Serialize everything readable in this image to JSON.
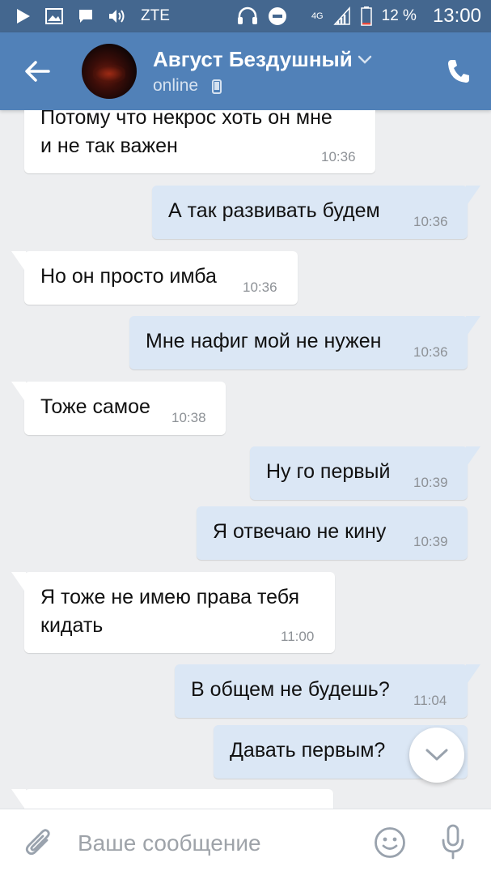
{
  "status_bar": {
    "carrier": "ZTE",
    "network": "4G",
    "battery": "12 %",
    "time": "13:00"
  },
  "header": {
    "contact_name": "Август Бездушный",
    "contact_status": "online"
  },
  "messages": [
    {
      "direction": "in",
      "text": "Потому что некрос хоть он мне\nи не так важен",
      "time": "10:36"
    },
    {
      "direction": "out",
      "text": "А так развивать будем",
      "time": "10:36"
    },
    {
      "direction": "in",
      "text": "Но он просто имба",
      "time": "10:36"
    },
    {
      "direction": "out",
      "text": "Мне нафиг мой не нужен",
      "time": "10:36"
    },
    {
      "direction": "in",
      "text": "Тоже самое",
      "time": "10:38"
    },
    {
      "direction": "out",
      "text": "Ну го первый",
      "time": "10:39"
    },
    {
      "direction": "out",
      "text": "Я отвечаю не кину",
      "time": "10:39"
    },
    {
      "direction": "in",
      "text": "Я тоже не имею права тебя\nкидать",
      "time": "11:00"
    },
    {
      "direction": "out",
      "text": "В общем не будешь?",
      "time": "11:04"
    },
    {
      "direction": "out",
      "text": "Давать первым?",
      "time": ""
    },
    {
      "direction": "in",
      "text": "",
      "time": ""
    }
  ],
  "input": {
    "placeholder": "Ваше сообщение",
    "value": ""
  },
  "colors": {
    "status_bar": "#44678f",
    "header": "#5181b8",
    "chat_background": "#edeef0",
    "incoming_bubble": "#ffffff",
    "outgoing_bubble": "#dbe7f5",
    "time_text": "#8d9196",
    "icon_gray": "#99a2ad"
  },
  "icons": {
    "back": "arrow-left-icon",
    "chevron": "chevron-down-icon",
    "phone": "phone-icon",
    "mobile": "mobile-device-icon",
    "scroll_down": "chevron-down-icon",
    "attach": "paperclip-icon",
    "emoji": "smiley-icon",
    "mic": "microphone-icon"
  }
}
